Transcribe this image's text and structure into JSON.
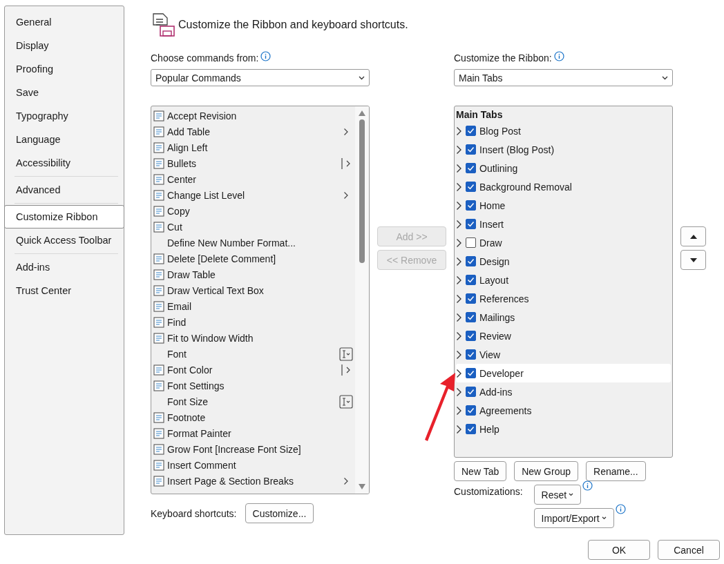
{
  "sidebar": {
    "groups": [
      {
        "items": [
          {
            "label": "General",
            "selected": false
          },
          {
            "label": "Display",
            "selected": false
          },
          {
            "label": "Proofing",
            "selected": false
          },
          {
            "label": "Save",
            "selected": false
          },
          {
            "label": "Typography",
            "selected": false
          },
          {
            "label": "Language",
            "selected": false
          },
          {
            "label": "Accessibility",
            "selected": false
          }
        ]
      },
      {
        "items": [
          {
            "label": "Advanced",
            "selected": false
          }
        ]
      },
      {
        "items": [
          {
            "label": "Customize Ribbon",
            "selected": true
          },
          {
            "label": "Quick Access Toolbar",
            "selected": false
          }
        ]
      },
      {
        "items": [
          {
            "label": "Add-ins",
            "selected": false
          },
          {
            "label": "Trust Center",
            "selected": false
          }
        ]
      }
    ]
  },
  "header": {
    "title": "Customize the Ribbon and keyboard shortcuts."
  },
  "commands": {
    "label": "Choose commands from:",
    "dropdown": "Popular Commands",
    "items": [
      {
        "label": "Accept Revision",
        "icon": true,
        "kind": "plain"
      },
      {
        "label": "Add Table",
        "icon": true,
        "kind": "submenu"
      },
      {
        "label": "Align Left",
        "icon": true,
        "kind": "plain"
      },
      {
        "label": "Bullets",
        "icon": true,
        "kind": "split"
      },
      {
        "label": "Center",
        "icon": true,
        "kind": "plain"
      },
      {
        "label": "Change List Level",
        "icon": true,
        "kind": "submenu"
      },
      {
        "label": "Copy",
        "icon": true,
        "kind": "plain"
      },
      {
        "label": "Cut",
        "icon": true,
        "kind": "plain"
      },
      {
        "label": "Define New Number Format...",
        "icon": false,
        "kind": "plain"
      },
      {
        "label": "Delete [Delete Comment]",
        "icon": true,
        "kind": "plain"
      },
      {
        "label": "Draw Table",
        "icon": true,
        "kind": "plain"
      },
      {
        "label": "Draw Vertical Text Box",
        "icon": true,
        "kind": "plain"
      },
      {
        "label": "Email",
        "icon": true,
        "kind": "plain"
      },
      {
        "label": "Find",
        "icon": true,
        "kind": "plain"
      },
      {
        "label": "Fit to Window Width",
        "icon": true,
        "kind": "plain"
      },
      {
        "label": "Font",
        "icon": false,
        "kind": "field"
      },
      {
        "label": "Font Color",
        "icon": true,
        "kind": "split"
      },
      {
        "label": "Font Settings",
        "icon": true,
        "kind": "plain"
      },
      {
        "label": "Font Size",
        "icon": false,
        "kind": "field"
      },
      {
        "label": "Footnote",
        "icon": true,
        "kind": "plain"
      },
      {
        "label": "Format Painter",
        "icon": true,
        "kind": "plain"
      },
      {
        "label": "Grow Font [Increase Font Size]",
        "icon": true,
        "kind": "plain"
      },
      {
        "label": "Insert Comment",
        "icon": true,
        "kind": "plain"
      },
      {
        "label": "Insert Page & Section Breaks",
        "icon": true,
        "kind": "submenu"
      }
    ]
  },
  "middle_buttons": [
    {
      "label": "Add >>",
      "disabled": true
    },
    {
      "label": "<< Remove",
      "disabled": true
    }
  ],
  "ribbon": {
    "label": "Customize the Ribbon:",
    "dropdown": "Main Tabs",
    "tree_title": "Main Tabs",
    "tabs": [
      {
        "label": "Blog Post",
        "checked": true,
        "selected": false
      },
      {
        "label": "Insert (Blog Post)",
        "checked": true,
        "selected": false
      },
      {
        "label": "Outlining",
        "checked": true,
        "selected": false
      },
      {
        "label": "Background Removal",
        "checked": true,
        "selected": false
      },
      {
        "label": "Home",
        "checked": true,
        "selected": false
      },
      {
        "label": "Insert",
        "checked": true,
        "selected": false
      },
      {
        "label": "Draw",
        "checked": false,
        "selected": false
      },
      {
        "label": "Design",
        "checked": true,
        "selected": false
      },
      {
        "label": "Layout",
        "checked": true,
        "selected": false
      },
      {
        "label": "References",
        "checked": true,
        "selected": false
      },
      {
        "label": "Mailings",
        "checked": true,
        "selected": false
      },
      {
        "label": "Review",
        "checked": true,
        "selected": false
      },
      {
        "label": "View",
        "checked": true,
        "selected": false
      },
      {
        "label": "Developer",
        "checked": true,
        "selected": true
      },
      {
        "label": "Add-ins",
        "checked": true,
        "selected": false
      },
      {
        "label": "Agreements",
        "checked": true,
        "selected": false
      },
      {
        "label": "Help",
        "checked": true,
        "selected": false
      }
    ],
    "buttons": [
      "New Tab",
      "New Group",
      "Rename..."
    ],
    "customizations_label": "Customizations:",
    "reset": "Reset",
    "import_export": "Import/Export"
  },
  "keyboard": {
    "label": "Keyboard shortcuts:",
    "button": "Customize..."
  },
  "footer": {
    "buttons": [
      "OK",
      "Cancel"
    ]
  }
}
